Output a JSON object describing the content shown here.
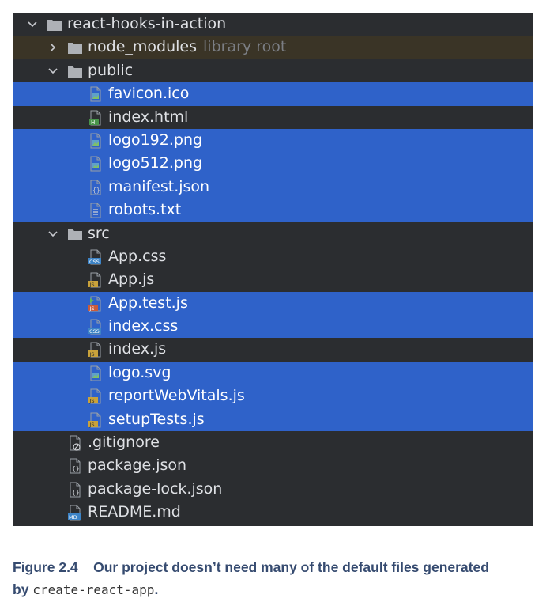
{
  "tree": {
    "rows": [
      {
        "label": "react-hooks-in-action",
        "indent": 0,
        "type": "folder",
        "expanded": true,
        "selected": false
      },
      {
        "label": "node_modules",
        "hint": "library root",
        "indent": 1,
        "type": "folder",
        "expanded": false,
        "selected": false,
        "excluded": true
      },
      {
        "label": "public",
        "indent": 1,
        "type": "folder",
        "expanded": true,
        "selected": false
      },
      {
        "label": "favicon.ico",
        "indent": 2,
        "type": "image",
        "selected": true
      },
      {
        "label": "index.html",
        "indent": 2,
        "type": "html",
        "selected": false
      },
      {
        "label": "logo192.png",
        "indent": 2,
        "type": "image",
        "selected": true
      },
      {
        "label": "logo512.png",
        "indent": 2,
        "type": "image",
        "selected": true
      },
      {
        "label": "manifest.json",
        "indent": 2,
        "type": "json",
        "selected": true
      },
      {
        "label": "robots.txt",
        "indent": 2,
        "type": "text",
        "selected": true
      },
      {
        "label": "src",
        "indent": 1,
        "type": "folder",
        "expanded": true,
        "selected": false
      },
      {
        "label": "App.css",
        "indent": 2,
        "type": "css",
        "selected": false
      },
      {
        "label": "App.js",
        "indent": 2,
        "type": "js",
        "selected": false
      },
      {
        "label": "App.test.js",
        "indent": 2,
        "type": "test-js",
        "selected": true
      },
      {
        "label": "index.css",
        "indent": 2,
        "type": "css",
        "selected": true
      },
      {
        "label": "index.js",
        "indent": 2,
        "type": "js",
        "selected": false
      },
      {
        "label": "logo.svg",
        "indent": 2,
        "type": "image",
        "selected": true
      },
      {
        "label": "reportWebVitals.js",
        "indent": 2,
        "type": "js",
        "selected": true
      },
      {
        "label": "setupTests.js",
        "indent": 2,
        "type": "js",
        "selected": true
      },
      {
        "label": ".gitignore",
        "indent": 1,
        "type": "ignore",
        "selected": false
      },
      {
        "label": "package.json",
        "indent": 1,
        "type": "json",
        "selected": false
      },
      {
        "label": "package-lock.json",
        "indent": 1,
        "type": "json",
        "selected": false
      },
      {
        "label": "README.md",
        "indent": 1,
        "type": "md",
        "selected": false
      }
    ]
  },
  "caption": {
    "figure": "Figure 2.4",
    "text": "Our project doesn’t need many of the default files generated",
    "by": "by",
    "code": "create-react-app",
    "end": "."
  },
  "colors": {
    "background": "#2b2d30",
    "selection": "#2f62c9",
    "excluded": "#3a3426",
    "caption": "#364b70"
  }
}
